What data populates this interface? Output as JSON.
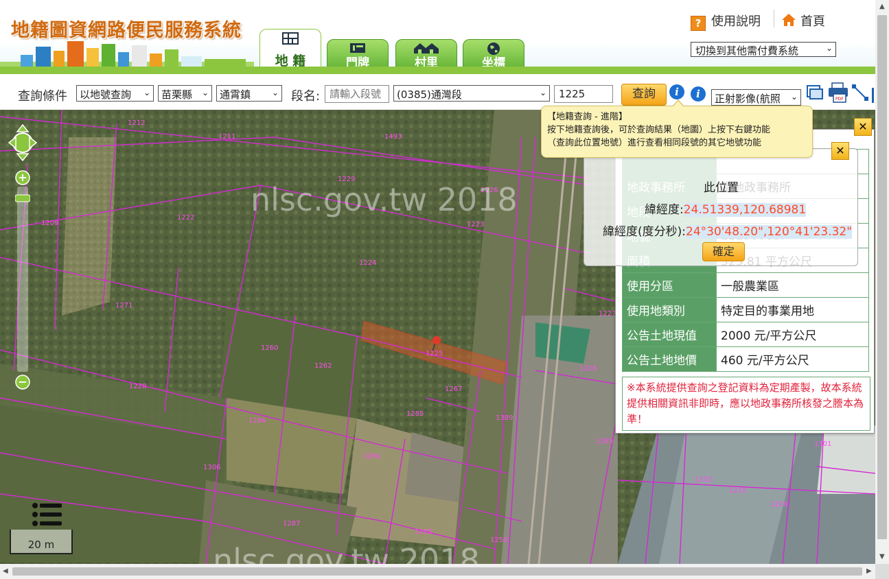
{
  "header": {
    "title": "地籍圖資網路便民服務系統",
    "tabs": [
      {
        "label": "地 籍",
        "icon": "map-grid-icon",
        "active": true
      },
      {
        "label": "門牌",
        "icon": "door-plate-icon",
        "active": false
      },
      {
        "label": "村里",
        "icon": "village-icon",
        "active": false
      },
      {
        "label": "坐標",
        "icon": "globe-icon",
        "active": false
      }
    ],
    "help_label": "使用說明",
    "home_label": "首頁",
    "system_select": "切換到其他需付費系統"
  },
  "query": {
    "condition_label": "查詢條件",
    "mode": "以地號查詢",
    "county": "苗栗縣",
    "town": "通霄鎮",
    "section_label": "段名:",
    "section_placeholder": "請輸入段號",
    "section": "(0385)通灣段",
    "parcel_number": "1225",
    "query_button": "查詢",
    "imagery_select": "正射影像(航照"
  },
  "tooltip": {
    "title": "【地籍查詢 - 進階】",
    "line1": "按下地籍查詢後，可於查詢結果（地圖）上按下右鍵功能",
    "line2": "（查詢此位置地號）進行查看相同段號的其它地號功能"
  },
  "map": {
    "watermark": "nlsc.gov.tw 2018",
    "scale": "20 m",
    "parcel_labels": [
      "1212",
      "1211",
      "1493",
      "1229",
      "1226",
      "1222",
      "1223",
      "1209",
      "1224",
      "1227",
      "1271",
      "1228",
      "1225",
      "1267",
      "1260",
      "1262",
      "1228",
      "1286",
      "1285",
      "1284",
      "1306",
      "1287",
      "1205",
      "1250",
      "1285",
      "1301",
      "1252",
      "1215",
      "1226",
      "1389"
    ]
  },
  "result": {
    "rows": [
      {
        "key": "",
        "value": ""
      },
      {
        "key": "地政事務所",
        "value": "霄地政事務所"
      },
      {
        "key": "地段",
        "value": "0385 通灣段"
      },
      {
        "key": "地號",
        "value": "12250000"
      },
      {
        "key": "面積",
        "value": "325.81 平方公尺"
      },
      {
        "key": "使用分區",
        "value": "一般農業區"
      },
      {
        "key": "使用地類別",
        "value": "特定目的事業用地"
      },
      {
        "key": "公告土地現值",
        "value": "2000 元/平方公尺"
      },
      {
        "key": "公告土地地價",
        "value": "460 元/平方公尺"
      }
    ],
    "note": "※本系統提供查詢之登記資料為定期產製，故本系統提供相關資訊非即時，應以地政事務所核發之謄本為準！"
  },
  "coord_popup": {
    "title": "此位置",
    "decimal_label": "緯經度:",
    "decimal_value": "24.51339,120.68981",
    "dms_label": "緯經度(度分秒):",
    "dms_value": "24°30'48.20\",120°41'23.32\"",
    "confirm": "確定"
  }
}
